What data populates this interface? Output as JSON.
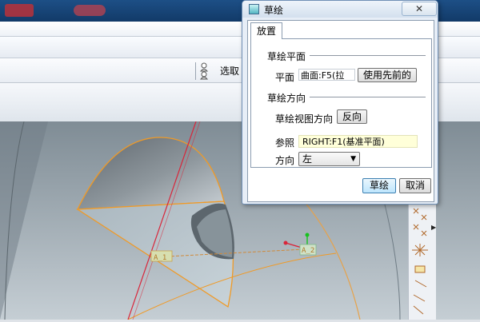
{
  "dialog": {
    "title": "草绘",
    "close_label": "✕",
    "tab": "放置",
    "section_plane": "草绘平面",
    "plane_label": "平面",
    "plane_value": "曲面:F5(拉",
    "use_previous_label": "使用先前的",
    "section_orientation": "草绘方向",
    "view_dir_label": "草绘视图方向",
    "flip_label": "反向",
    "reference_label": "参照",
    "reference_value": "RIGHT:F1(基准平面)",
    "direction_label": "方向",
    "direction_value": "左",
    "sketch_button": "草绘",
    "cancel_button": "取消"
  },
  "app": {
    "select_label": "选取",
    "datum_label": "A_1",
    "datum_label2": "A_2"
  },
  "colors": {
    "viewport_top": "#7d8b94",
    "viewport_bottom": "#c3cdd3",
    "model_edge": "#f09a26",
    "axis": "#d9253a",
    "dialog_bg": "#e7eef7"
  },
  "icons": {
    "dialog_icon": "sketch-app-icon",
    "people": "people-icon"
  }
}
